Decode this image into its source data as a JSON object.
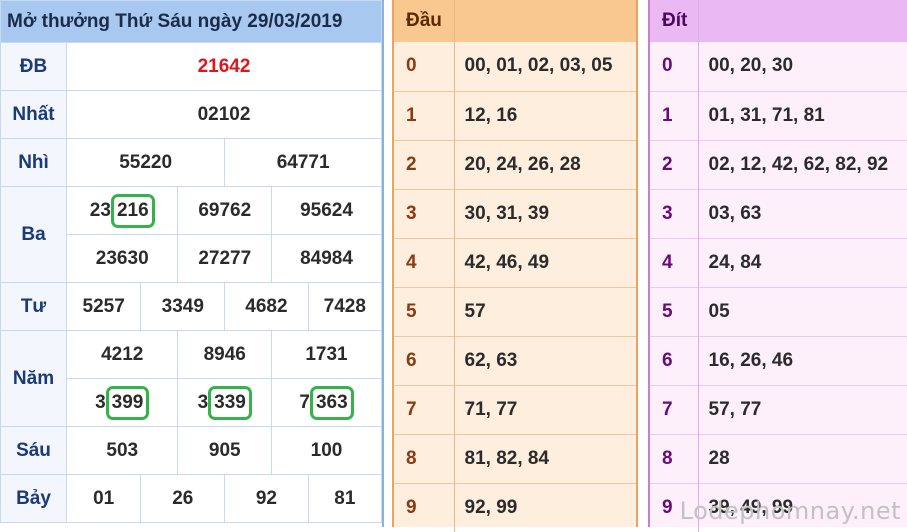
{
  "results": {
    "title": "Mở thưởng Thứ Sáu ngày 29/03/2019",
    "labels": {
      "db": "ĐB",
      "nhat": "Nhất",
      "nhi": "Nhì",
      "ba": "Ba",
      "tu": "Tư",
      "nam": "Năm",
      "sau": "Sáu",
      "bay": "Bảy"
    },
    "db": "21642",
    "nhat": "02102",
    "nhi": [
      "55220",
      "64771"
    ],
    "ba": [
      "23216",
      "69762",
      "95624",
      "23630",
      "27277",
      "84984"
    ],
    "tu": [
      "5257",
      "3349",
      "4682",
      "7428"
    ],
    "nam": [
      "4212",
      "8946",
      "1731",
      "3399",
      "3339",
      "7363"
    ],
    "sau": [
      "503",
      "905",
      "100"
    ],
    "bay": [
      "01",
      "26",
      "92",
      "81"
    ],
    "circled_parts": {
      "ba_0_prefix": "23",
      "ba_0_circled": "216",
      "nam_3_prefix": "3",
      "nam_3_circled": "399",
      "nam_4_prefix": "3",
      "nam_4_circled": "339",
      "nam_5_prefix": "7",
      "nam_5_circled": "363"
    }
  },
  "dau": {
    "header": "Đầu",
    "rows": [
      {
        "k": "0",
        "v": "00, 01, 02, 03, 05"
      },
      {
        "k": "1",
        "v": "12, 16"
      },
      {
        "k": "2",
        "v": "20, 24, 26, 28"
      },
      {
        "k": "3",
        "v": "30, 31, 39"
      },
      {
        "k": "4",
        "v": "42, 46, 49"
      },
      {
        "k": "5",
        "v": "57"
      },
      {
        "k": "6",
        "v": "62, 63"
      },
      {
        "k": "7",
        "v": "71, 77"
      },
      {
        "k": "8",
        "v": "81, 82, 84"
      },
      {
        "k": "9",
        "v": "92, 99"
      }
    ]
  },
  "dit": {
    "header": "Đít",
    "rows": [
      {
        "k": "0",
        "v": "00, 20, 30"
      },
      {
        "k": "1",
        "v": "01, 31, 71, 81"
      },
      {
        "k": "2",
        "v": "02, 12, 42, 62, 82, 92"
      },
      {
        "k": "3",
        "v": "03, 63"
      },
      {
        "k": "4",
        "v": "24, 84"
      },
      {
        "k": "5",
        "v": "05"
      },
      {
        "k": "6",
        "v": "16, 26, 46"
      },
      {
        "k": "7",
        "v": "57, 77"
      },
      {
        "k": "8",
        "v": "28"
      },
      {
        "k": "9",
        "v": "39, 49, 99"
      }
    ]
  },
  "watermark": "Lodephomnay.net",
  "colors": {
    "accent_db": "#e0161b",
    "circle": "#35b34a"
  }
}
